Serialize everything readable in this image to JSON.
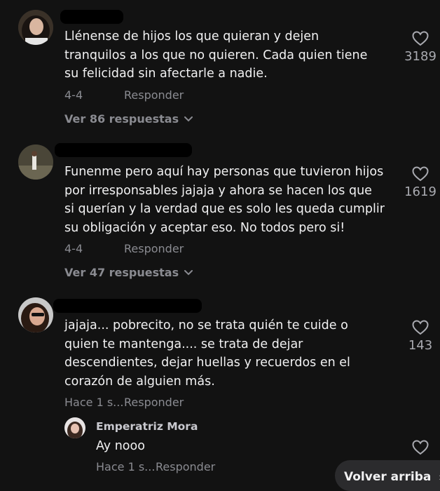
{
  "comments": [
    {
      "text_lines": [
        "Llénense de hijos los que quieran y dejen",
        "tranquilos a los que no quieren. Cada quien tiene",
        "su felicidad sin afectarle a nadie."
      ],
      "date": "4-4",
      "reply_label": "Responder",
      "likes": "3189",
      "view_replies": "Ver 86 respuestas"
    },
    {
      "text_lines": [
        "Funenme pero aquí hay personas que tuvieron hijos",
        "por irresponsables jajaja y ahora se hacen los que",
        "si querían y la verdad que es solo les queda cumplir",
        "su obligación y aceptar eso. No todos pero si!"
      ],
      "date": "4-4",
      "reply_label": "Responder",
      "likes": "1619",
      "view_replies": "Ver 47 respuestas"
    },
    {
      "text_lines": [
        "jajaja... pobrecito, no se trata quién te cuide o",
        "quien te mantenga.... se trata de dejar",
        "descendientes, dejar huellas y recuerdos en el",
        "corazón de alguien más."
      ],
      "date": "Hace 1 s...",
      "reply_label": "Responder",
      "likes": "143"
    }
  ],
  "reply": {
    "author": "Emperatriz Mora",
    "text": "Ay nooo",
    "date": "Hace 1 s...",
    "reply_label": "Responder"
  },
  "back_to_top": "Volver arriba",
  "icons": {
    "like": "heart-outline-icon",
    "expand": "chevron-down-icon",
    "back_to_top": "double-chevron-up-icon"
  },
  "colors": {
    "background": "#121212",
    "text": "#f1f1f2",
    "muted": "#8a8b91"
  }
}
